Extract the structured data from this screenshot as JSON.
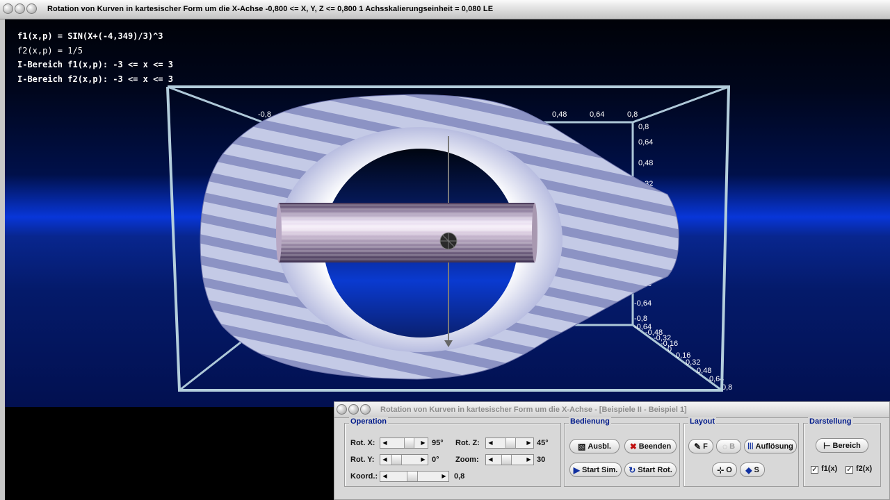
{
  "window": {
    "title": "Rotation von Kurven in kartesischer Form um die X-Achse   -0,800 <= X, Y, Z <= 0,800   1 Achsskalierungseinheit = 0,080 LE"
  },
  "formulas": {
    "f1": "f1(x,p) = SIN(X+(-4,349)/3)^3",
    "f2": "f2(x,p) = 1/5",
    "range1": "I-Bereich f1(x,p): -3 <= x <= 3",
    "range2": "I-Bereich f2(x,p): -3 <= x <= 3"
  },
  "axes": {
    "top_labels": [
      "-0,8",
      "0,48",
      "0,64",
      "0,8"
    ],
    "right_labels": [
      "0,8",
      "0,64",
      "0,48",
      "0,32",
      "-0,48",
      "-0,64",
      "-0,8"
    ],
    "depth_labels": [
      "-0,64",
      "-0,48",
      "-0,32",
      "-0,16",
      "0",
      "0,16",
      "0,32",
      "0,48",
      "0,64",
      "0,8"
    ]
  },
  "panel": {
    "title": "Rotation von Kurven in kartesischer Form um die X-Achse - [Beispiele II - Beispiel 1]",
    "groups": {
      "operation": "Operation",
      "bedienung": "Bedienung",
      "layout": "Layout",
      "darstellung": "Darstellung"
    },
    "operation": {
      "rot_x_label": "Rot. X:",
      "rot_x_value": "95°",
      "rot_y_label": "Rot. Y:",
      "rot_y_value": "0°",
      "koord_label": "Koord.:",
      "koord_value": "0,8",
      "rot_z_label": "Rot. Z:",
      "rot_z_value": "45°",
      "zoom_label": "Zoom:",
      "zoom_value": "30"
    },
    "bedienung": {
      "ausbl": "Ausbl.",
      "beenden": "Beenden",
      "start_sim": "Start Sim.",
      "start_rot": "Start Rot."
    },
    "layout": {
      "f": "F",
      "b": "B",
      "aufloesung": "Auflösung",
      "o": "O",
      "s": "S"
    },
    "darstellung": {
      "bereich": "Bereich",
      "f1": "f1(x)",
      "f2": "f2(x)",
      "f1_checked": true,
      "f2_checked": true
    }
  },
  "colors": {
    "group_label": "#001a8a",
    "close_icon": "#c01010"
  }
}
